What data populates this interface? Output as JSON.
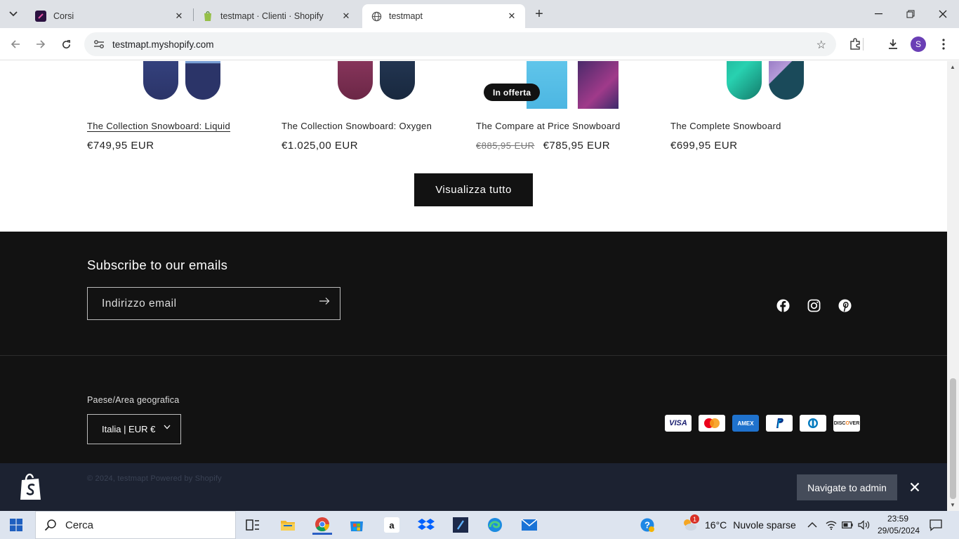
{
  "browser": {
    "tabs": [
      {
        "title": "Corsi",
        "active": false
      },
      {
        "title": "testmapt · Clienti · Shopify",
        "active": false
      },
      {
        "title": "testmapt",
        "active": true
      }
    ],
    "url": "testmapt.myshopify.com",
    "profile_initial": "S"
  },
  "products": [
    {
      "name": "The Collection Snowboard: Liquid",
      "price": "€749,95 EUR"
    },
    {
      "name": "The Collection Snowboard: Oxygen",
      "price": "€1.025,00 EUR"
    },
    {
      "name": "The Compare at Price Snowboard",
      "compare_price": "€885,95 EUR",
      "price": "€785,95 EUR",
      "badge": "In offerta"
    },
    {
      "name": "The Complete Snowboard",
      "price": "€699,95 EUR"
    }
  ],
  "view_all_label": "Visualizza tutto",
  "footer": {
    "newsletter_title": "Subscribe to our emails",
    "email_placeholder": "Indirizzo email",
    "social": [
      "facebook-icon",
      "instagram-icon",
      "pinterest-icon"
    ],
    "country_label": "Paese/Area geografica",
    "country_value": "Italia | EUR €",
    "payment_methods": [
      "Visa",
      "Mastercard",
      "American Express",
      "PayPal",
      "Diners Club",
      "Discover"
    ],
    "copyright": "© 2024, testmapt Powered by Shopify"
  },
  "admin_bar": {
    "navigate_label": "Navigate to admin"
  },
  "taskbar": {
    "search_label": "Cerca",
    "weather_temp": "16°C",
    "weather_desc": "Nuvole sparse",
    "weather_badge": "1",
    "time": "23:59",
    "date": "29/05/2024"
  },
  "colors": {
    "footer_bg": "#121212",
    "admin_bar_bg": "#1c2231",
    "accent_profile": "#6a3fb5"
  }
}
